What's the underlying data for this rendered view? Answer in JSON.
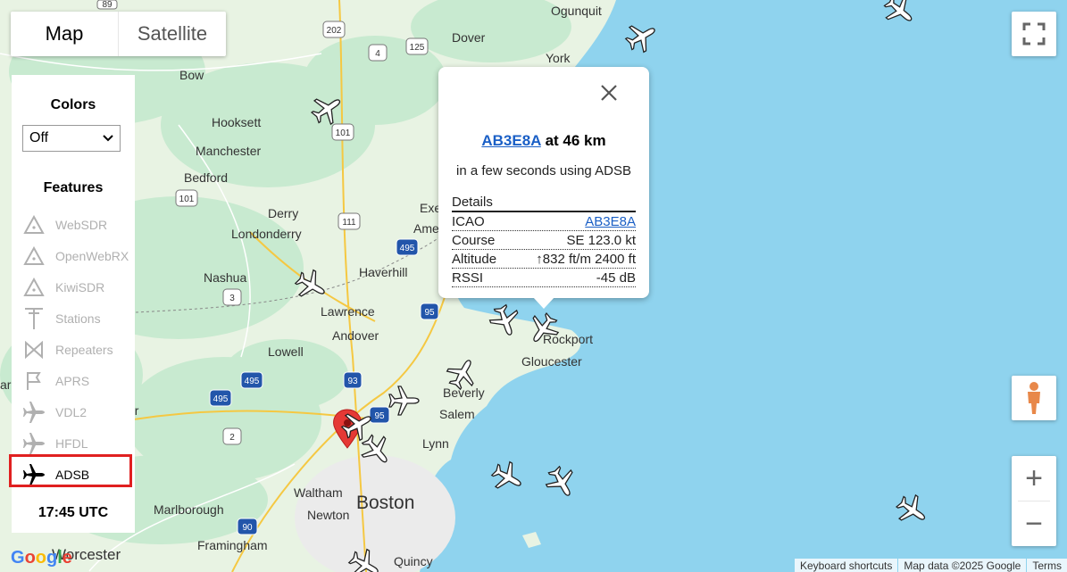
{
  "map_type": {
    "map_label": "Map",
    "satellite_label": "Satellite",
    "selected": "Map"
  },
  "places": [
    {
      "name": "Ogunquit"
    },
    {
      "name": "Dover"
    },
    {
      "name": "York"
    },
    {
      "name": "Bow"
    },
    {
      "name": "Hooksett"
    },
    {
      "name": "Manchester"
    },
    {
      "name": "Bedford"
    },
    {
      "name": "Exeter"
    },
    {
      "name": "Derry"
    },
    {
      "name": "Londonderry"
    },
    {
      "name": "Ame"
    },
    {
      "name": "Haverhill"
    },
    {
      "name": "Nashua"
    },
    {
      "name": "Lawrence"
    },
    {
      "name": "Andover"
    },
    {
      "name": "Lowell"
    },
    {
      "name": "Rockport"
    },
    {
      "name": "Gloucester"
    },
    {
      "name": "Beverly"
    },
    {
      "name": "Salem"
    },
    {
      "name": "Lynn"
    },
    {
      "name": "Waltham"
    },
    {
      "name": "Boston"
    },
    {
      "name": "Newton"
    },
    {
      "name": "Marlborough"
    },
    {
      "name": "Framingham"
    },
    {
      "name": "Worcester"
    },
    {
      "name": "Quincy"
    },
    {
      "name": "arc"
    },
    {
      "name": "er"
    }
  ],
  "shields": [
    "89",
    "202",
    "125",
    "4",
    "101",
    "101",
    "111",
    "495",
    "3",
    "95",
    "93",
    "495",
    "495",
    "95",
    "2",
    "90"
  ],
  "panel": {
    "colors_heading": "Colors",
    "colors_value": "Off",
    "features_heading": "Features",
    "features": [
      {
        "label": "WebSDR",
        "icon": "triangle-icon",
        "active": false
      },
      {
        "label": "OpenWebRX",
        "icon": "triangle-icon",
        "active": false
      },
      {
        "label": "KiwiSDR",
        "icon": "triangle-icon",
        "active": false
      },
      {
        "label": "Stations",
        "icon": "antenna-icon",
        "active": false
      },
      {
        "label": "Repeaters",
        "icon": "bowtie-icon",
        "active": false
      },
      {
        "label": "APRS",
        "icon": "flag-icon",
        "active": false
      },
      {
        "label": "VDL2",
        "icon": "airplane-icon",
        "active": false
      },
      {
        "label": "HFDL",
        "icon": "airplane-icon",
        "active": false
      },
      {
        "label": "ADSB",
        "icon": "airplane-icon",
        "active": true
      }
    ],
    "time": "17:45 UTC"
  },
  "popup": {
    "callsign": "AB3E8A",
    "distance": "at 46 km",
    "subtitle": "in a few seconds using ADSB",
    "details_heading": "Details",
    "rows": [
      {
        "label": "ICAO",
        "value": "AB3E8A",
        "link": true
      },
      {
        "label": "Course",
        "value": "SE 123.0 kt",
        "link": false
      },
      {
        "label": "Altitude",
        "value": "↑832 ft/m 2400 ft",
        "link": false
      },
      {
        "label": "RSSI",
        "value": "-45 dB",
        "link": false
      }
    ]
  },
  "attribution": {
    "shortcuts": "Keyboard shortcuts",
    "mapdata": "Map data ©2025 Google",
    "terms": "Terms"
  },
  "logo": "Google",
  "colors": {
    "water": "#8fd3ee",
    "land": "#e8f3e3",
    "green": "#c5e8c5",
    "urban": "#ececec",
    "highlight": "#e02020",
    "link": "#1a5fc6"
  }
}
